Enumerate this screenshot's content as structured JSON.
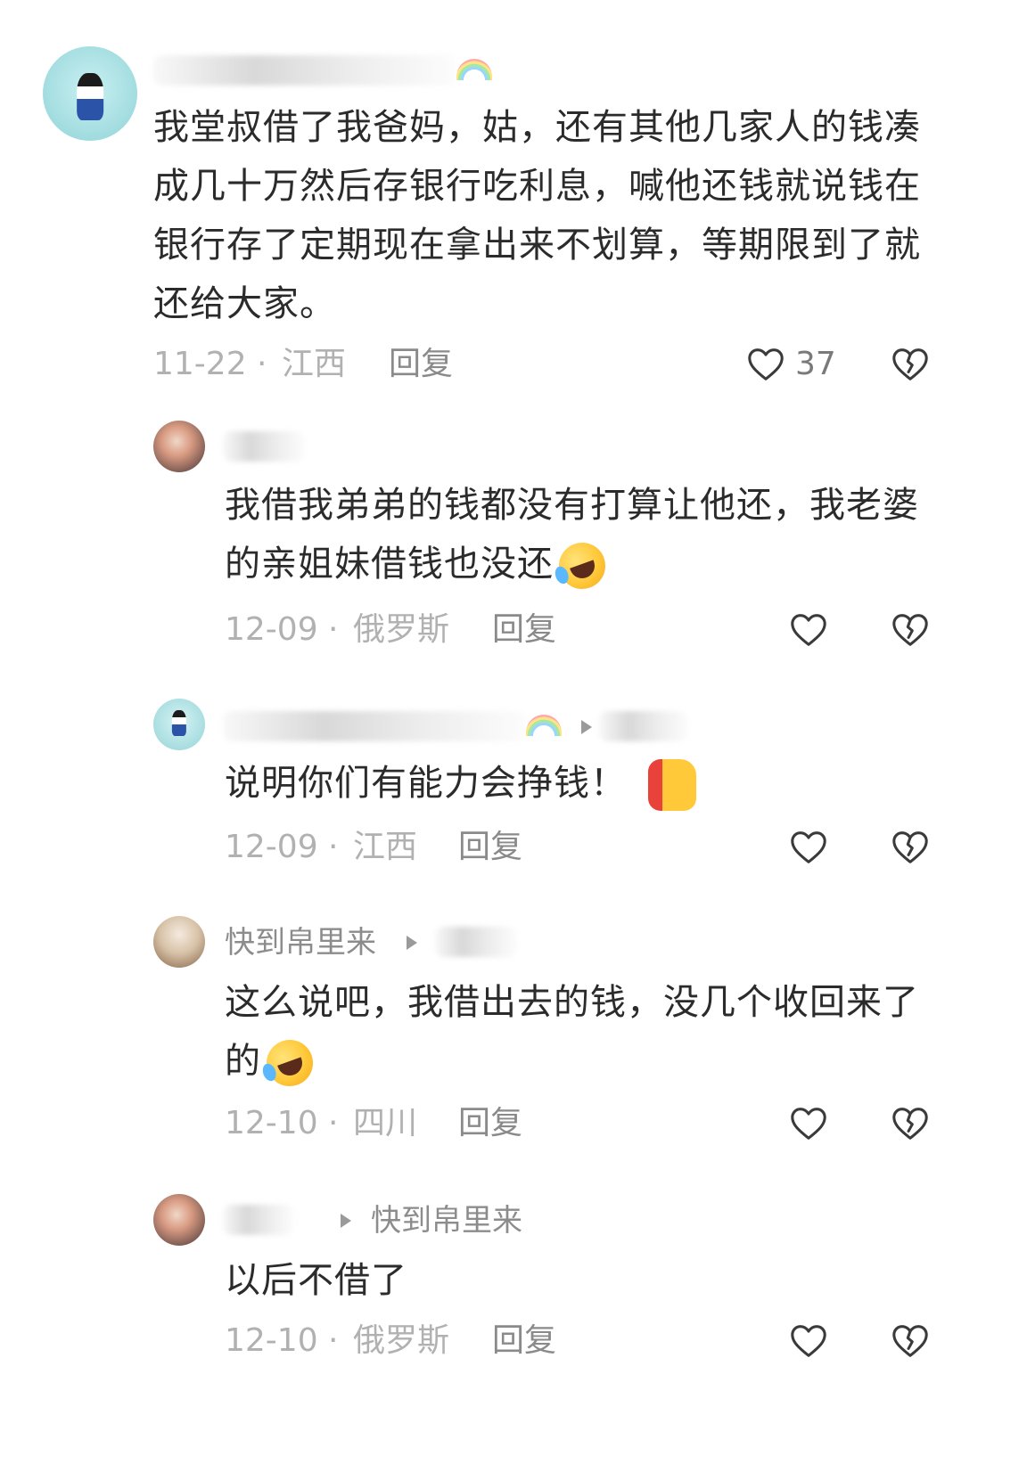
{
  "comments": [
    {
      "username": "",
      "reply_to": "",
      "text": "我堂叔借了我爸妈，姑，还有其他几家人的钱凑成几十万然后存银行吃利息，喊他还钱就说钱在银行存了定期现在拿出来不划算，等期限到了就还给大家。",
      "emoji": "",
      "date": "11-22",
      "separator": "·",
      "region": "江西",
      "reply_label": "回复",
      "likes": "37",
      "like_icon": "heart-outline-icon",
      "dislike_icon": "broken-heart-icon"
    },
    {
      "username": "",
      "reply_to": "",
      "text": "我借我弟弟的钱都没有打算让他还，我老婆的亲姐妹借钱也没还",
      "emoji": "laughing-crying-emoji",
      "date": "12-09",
      "separator": "·",
      "region": "俄罗斯",
      "reply_label": "回复",
      "likes": "",
      "like_icon": "heart-outline-icon",
      "dislike_icon": "broken-heart-icon"
    },
    {
      "username": "",
      "reply_to": "",
      "text": "说明你们有能力会挣钱！",
      "emoji": "thumbs-up-emoji",
      "date": "12-09",
      "separator": "·",
      "region": "江西",
      "reply_label": "回复",
      "likes": "",
      "like_icon": "heart-outline-icon",
      "dislike_icon": "broken-heart-icon"
    },
    {
      "username": "快到帛里来",
      "reply_to": "",
      "text": "这么说吧，我借出去的钱，没几个收回来了的",
      "emoji": "laughing-crying-emoji",
      "date": "12-10",
      "separator": "·",
      "region": "四川",
      "reply_label": "回复",
      "likes": "",
      "like_icon": "heart-outline-icon",
      "dislike_icon": "broken-heart-icon"
    },
    {
      "username": "",
      "reply_to": "快到帛里来",
      "text": "以后不借了",
      "emoji": "",
      "date": "12-10",
      "separator": "·",
      "region": "俄罗斯",
      "reply_label": "回复",
      "likes": "",
      "like_icon": "heart-outline-icon",
      "dislike_icon": "broken-heart-icon"
    }
  ],
  "colors": {
    "text": "#2b2b2b",
    "meta": "#b1b1b1",
    "username": "#8c8c8c",
    "reply_link": "#8a8a8a",
    "icon_stroke": "#3a3a3a"
  }
}
